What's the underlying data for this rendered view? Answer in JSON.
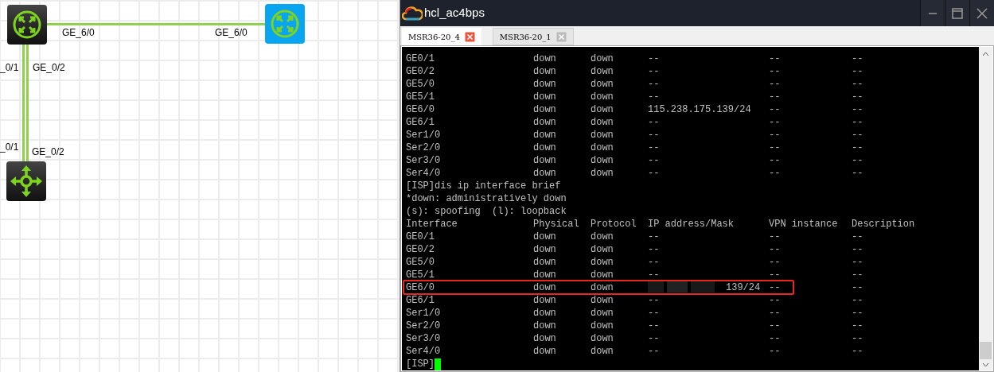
{
  "topology": {
    "nodes": [
      {
        "kind": "router",
        "selected": false
      },
      {
        "kind": "router",
        "selected": true
      },
      {
        "kind": "switch",
        "selected": false
      }
    ],
    "links": [
      {
        "kind": "horizontal"
      },
      {
        "kind": "vertical"
      },
      {
        "kind": "vertical"
      }
    ],
    "port_labels": [
      "GE_6/0",
      "GE_6/0",
      "_0/1",
      "GE_0/2",
      "_0/1",
      "GE_0/2"
    ]
  },
  "window": {
    "title": "hcl_ac4bps",
    "tabs": [
      {
        "label": "MSR36-20_4",
        "selected": true
      },
      {
        "label": "MSR36-20_1",
        "selected": false
      }
    ],
    "terminal": {
      "lines": [
        {
          "kind": "row",
          "cells": [
            "GE0/1",
            "down",
            "down",
            "--",
            "--",
            "--"
          ]
        },
        {
          "kind": "row",
          "cells": [
            "GE0/2",
            "down",
            "down",
            "--",
            "--",
            "--"
          ]
        },
        {
          "kind": "row",
          "cells": [
            "GE5/0",
            "down",
            "down",
            "--",
            "--",
            "--"
          ]
        },
        {
          "kind": "row",
          "cells": [
            "GE5/1",
            "down",
            "down",
            "--",
            "--",
            "--"
          ]
        },
        {
          "kind": "row",
          "cells": [
            "GE6/0",
            "down",
            "down",
            "115.238.175.139/24",
            "--",
            "--"
          ]
        },
        {
          "kind": "row",
          "cells": [
            "GE6/1",
            "down",
            "down",
            "--",
            "--",
            "--"
          ]
        },
        {
          "kind": "row",
          "cells": [
            "Ser1/0",
            "down",
            "down",
            "--",
            "--",
            "--"
          ]
        },
        {
          "kind": "row",
          "cells": [
            "Ser2/0",
            "down",
            "down",
            "--",
            "--",
            "--"
          ]
        },
        {
          "kind": "row",
          "cells": [
            "Ser3/0",
            "down",
            "down",
            "--",
            "--",
            "--"
          ]
        },
        {
          "kind": "row",
          "cells": [
            "Ser4/0",
            "down",
            "down",
            "--",
            "--",
            "--"
          ]
        },
        {
          "kind": "text",
          "text": "[ISP]dis ip interface brief"
        },
        {
          "kind": "text",
          "text": "*down: administratively down"
        },
        {
          "kind": "text",
          "text": "(s): spoofing  (l): loopback"
        },
        {
          "kind": "row",
          "cells": [
            "Interface",
            "Physical",
            "Protocol",
            "IP address/Mask",
            "VPN instance",
            "Description"
          ]
        },
        {
          "kind": "row",
          "cells": [
            "GE0/1",
            "down",
            "down",
            "--",
            "--",
            "--"
          ]
        },
        {
          "kind": "row",
          "cells": [
            "GE0/2",
            "down",
            "down",
            "--",
            "--",
            "--"
          ]
        },
        {
          "kind": "row",
          "cells": [
            "GE5/0",
            "down",
            "down",
            "--",
            "--",
            "--"
          ]
        },
        {
          "kind": "row",
          "cells": [
            "GE5/1",
            "down",
            "down",
            "--",
            "--",
            "--"
          ]
        },
        {
          "kind": "row",
          "cells": [
            "GE6/0",
            "down",
            "down",
            "139/24",
            "--",
            "--"
          ],
          "highlighted": true,
          "redacted": true
        },
        {
          "kind": "row",
          "cells": [
            "GE6/1",
            "down",
            "down",
            "--",
            "--",
            "--"
          ]
        },
        {
          "kind": "row",
          "cells": [
            "Ser1/0",
            "down",
            "down",
            "--",
            "--",
            "--"
          ]
        },
        {
          "kind": "row",
          "cells": [
            "Ser2/0",
            "down",
            "down",
            "--",
            "--",
            "--"
          ]
        },
        {
          "kind": "row",
          "cells": [
            "Ser3/0",
            "down",
            "down",
            "--",
            "--",
            "--"
          ]
        },
        {
          "kind": "row",
          "cells": [
            "Ser4/0",
            "down",
            "down",
            "--",
            "--",
            "--"
          ]
        },
        {
          "kind": "prompt",
          "text": "[ISP]"
        }
      ]
    }
  }
}
